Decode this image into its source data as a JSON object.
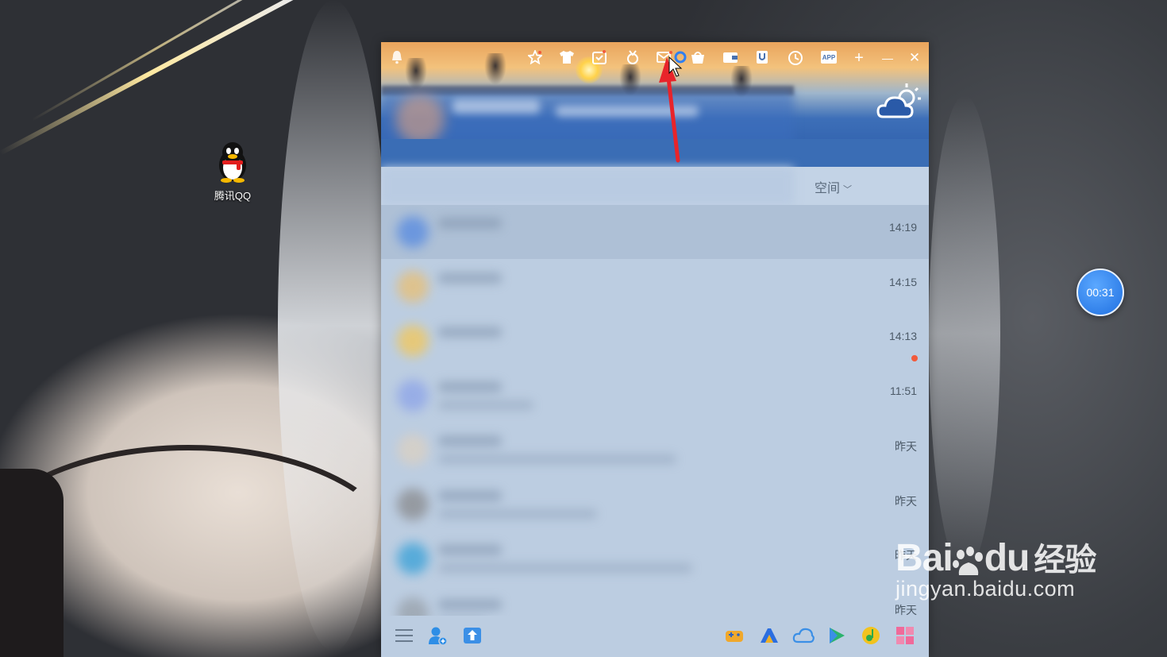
{
  "desktop": {
    "icons": [
      {
        "label": "腾讯QQ",
        "icon": "qq-penguin-icon"
      }
    ],
    "timer": "00:31",
    "watermark": {
      "brand_latin": "Bai",
      "brand_latin2": "du",
      "brand_cn": "经验",
      "url": "jingyan.baidu.com"
    }
  },
  "qq_window": {
    "toolbar_icons": [
      "bell-icon",
      "star-icon",
      "shirt-icon",
      "calendar-icon",
      "medal-icon",
      "mail-icon",
      "store-icon",
      "wallet-icon",
      "u-icon",
      "clock-icon",
      "app-icon"
    ],
    "app_label": "APP",
    "window_controls": {
      "add": "+",
      "minimize": "—",
      "close": "✕"
    },
    "weather_icon": "cloud-sun-icon",
    "space_tab": "空间",
    "conversations": [
      {
        "time": "14:19",
        "selected": true,
        "unread": false,
        "avatar_color": "#5b8de0"
      },
      {
        "time": "14:15",
        "selected": false,
        "unread": false,
        "avatar_color": "#e6c07a"
      },
      {
        "time": "14:13",
        "selected": false,
        "unread": true,
        "avatar_color": "#f0c860"
      },
      {
        "time": "11:51",
        "selected": false,
        "unread": false,
        "avatar_color": "#8fa6e8"
      },
      {
        "time": "昨天",
        "selected": false,
        "unread": false,
        "avatar_color": "#d9d0c4"
      },
      {
        "time": "昨天",
        "selected": false,
        "unread": false,
        "avatar_color": "#8c8e92"
      },
      {
        "time": "昨天",
        "selected": false,
        "unread": false,
        "avatar_color": "#3fa3d8"
      },
      {
        "time": "昨天",
        "selected": false,
        "unread": false,
        "avatar_color": "#9aa3ad"
      }
    ],
    "bottom_icons": [
      "menu-icon",
      "add-friend-icon",
      "file-transfer-icon",
      "game-icon",
      "game-center-icon",
      "cloud-icon",
      "video-icon",
      "music-icon",
      "more-apps-icon"
    ]
  },
  "colors": {
    "accent": "#2a5aa8",
    "list_bg": "#bccde1",
    "unread": "#f25a3b",
    "arrow": "#e8242a"
  }
}
